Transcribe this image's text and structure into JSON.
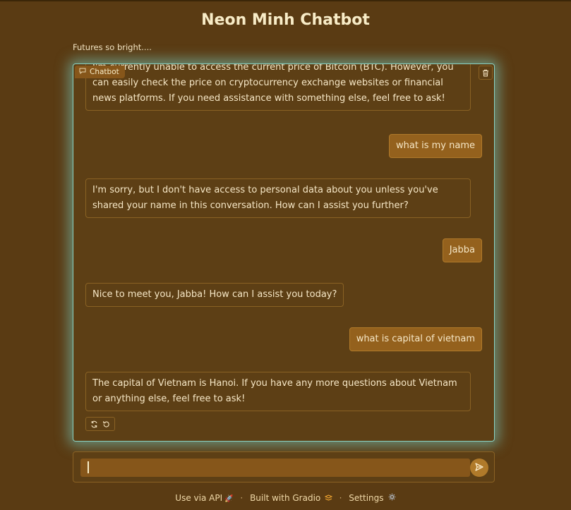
{
  "header": {
    "title": "Neon Minh Chatbot",
    "subtitle": "Futures so bright...."
  },
  "chatbot": {
    "label": "Chatbot",
    "messages": [
      {
        "role": "bot",
        "text": "I'm currently unable to access the current price of Bitcoin (BTC). However, you can easily check the price on cryptocurrency exchange websites or financial news platforms. If you need assistance with something else, feel free to ask!"
      },
      {
        "role": "user",
        "text": "what is my name"
      },
      {
        "role": "bot",
        "text": "I'm sorry, but I don't have access to personal data about you unless you've shared your name in this conversation. How can I assist you further?"
      },
      {
        "role": "user",
        "text": "Jabba"
      },
      {
        "role": "bot",
        "text": "Nice to meet you, Jabba! How can I assist you today?"
      },
      {
        "role": "user",
        "text": "what is capital of vietnam"
      },
      {
        "role": "bot",
        "text": "The capital of Vietnam is Hanoi. If you have any more questions about Vietnam or anything else, feel free to ask!"
      }
    ]
  },
  "input": {
    "value": "",
    "placeholder": ""
  },
  "footer": {
    "api": "Use via API",
    "gradio": "Built with Gradio",
    "settings": "Settings"
  },
  "icons": {
    "chat": "chat-bubble-icon",
    "trash": "trash-icon",
    "retry": "retry-icon",
    "undo": "undo-icon",
    "send": "send-icon",
    "rocket": "rocket-icon",
    "gradio": "gradio-logo-icon",
    "gear": "gear-icon"
  },
  "colors": {
    "background": "#5a3b13",
    "panel": "#5d3f15",
    "user_bubble": "#94611d",
    "glow": "#8ad3c4",
    "text": "#f6e7c6"
  }
}
